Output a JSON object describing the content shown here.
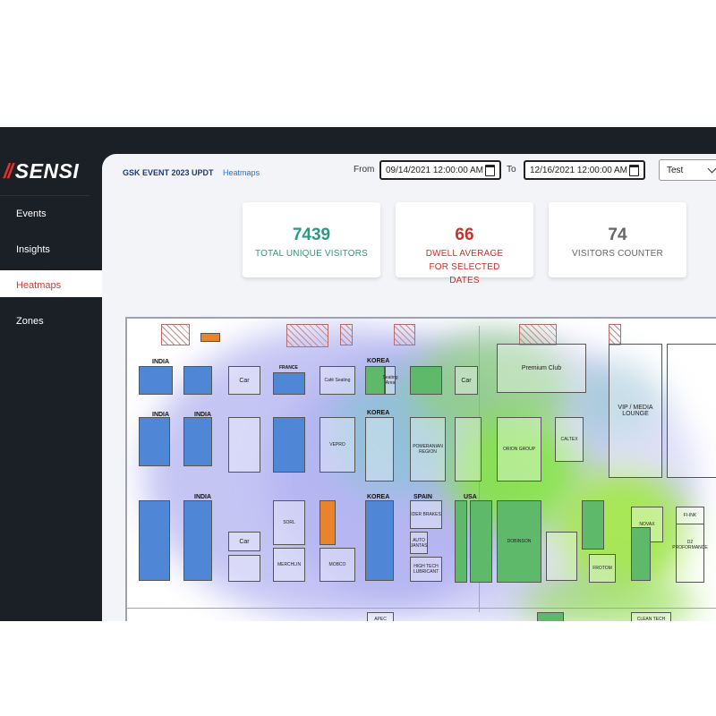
{
  "brand": {
    "slashes": "//",
    "name": "SENSI"
  },
  "sidebar": {
    "items": [
      {
        "label": "Events"
      },
      {
        "label": "Insights"
      },
      {
        "label": "Heatmaps"
      },
      {
        "label": "Zones"
      }
    ],
    "active": "Heatmaps",
    "active_color": "#d73a35"
  },
  "header": {
    "event": "GSK EVENT 2023 UPDT",
    "page": "Heatmaps",
    "from_label": "From",
    "from_value": "09/14/2021 12:00:00 AM",
    "to_label": "To",
    "to_value": "12/16/2021 12:00:00 AM",
    "select_value": "Test"
  },
  "stats": [
    {
      "value": "7439",
      "caption": "TOTAL UNIQUE VISITORS",
      "color": "#2a9a86"
    },
    {
      "value": "66",
      "caption": "DWELL AVERAGE FOR SELECTED DATES",
      "color": "#c8312c"
    },
    {
      "value": "74",
      "caption": "VISITORS COUNTER",
      "color": "#666666"
    }
  ],
  "floorplan": {
    "labels": {
      "india1": "INDIA",
      "india2": "INDIA",
      "india3": "INDIA",
      "india4": "INDIA",
      "korea1": "KOREA",
      "korea2": "KOREA",
      "korea3": "KOREA",
      "spain": "SPAIN",
      "usa": "USA",
      "france": "FRANCE",
      "car1": "Car",
      "car2": "Car",
      "car3": "Car",
      "premium": "Premium Club",
      "vip": "VIP / MEDIA LOUNGE",
      "seating": "Seating Area",
      "cafe": "Café Seating",
      "orion": "ORION GROUP",
      "pomerania": "POMERANIAN REGION",
      "caltex": "CALTEX",
      "vepro": "VEPRO",
      "sorl": "SORL",
      "merchlin": "MERCHLIN",
      "mobco": "MOBCO",
      "dobinson": "DOBINSON",
      "autojantas": "AUTO JANTAS",
      "hightech": "HIGH TECH LUBRICANT",
      "iderbrakes": "IDER BRAKES",
      "novax": "NOVAX",
      "fimmi": "FI-INK",
      "d2": "D2 PROFORMANCE",
      "apec": "APEC",
      "cleantech": "CLEAN TECH",
      "frotom": "FROTOM"
    }
  },
  "colors": {
    "sidebar_bg": "#1b1f26",
    "main_bg": "#f3f4f8",
    "accent": "#d73a35"
  },
  "icons": {
    "calendar": "calendar-icon",
    "chevron": "chevron-down-icon"
  }
}
